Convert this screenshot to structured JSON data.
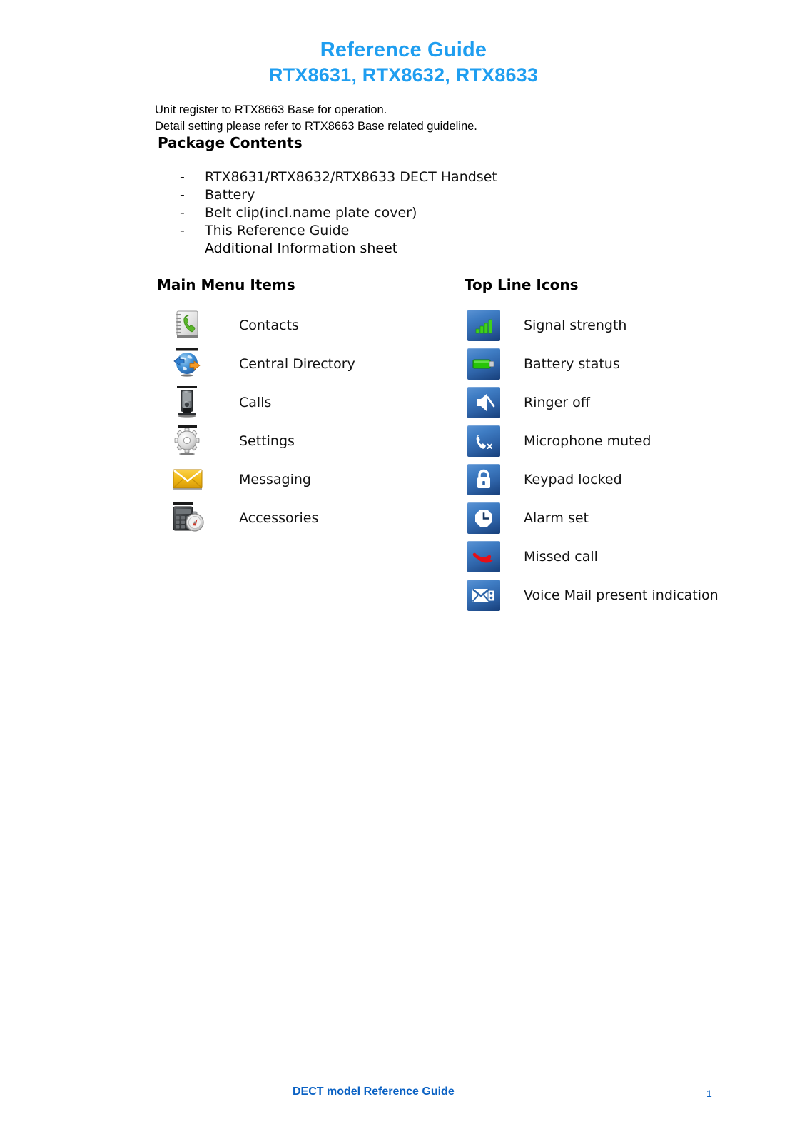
{
  "document": {
    "title": "Reference Guide",
    "subtitle": "RTX8631, RTX8632, RTX8633",
    "title_color": "#1f9ef0",
    "intro_line_1": "Unit register to RTX8663 Base for operation.",
    "intro_line_2": "Detail setting please refer to RTX8663 Base related guideline."
  },
  "package_contents": {
    "heading": "Package Contents",
    "bullet": "-",
    "items": [
      "RTX8631/RTX8632/RTX8633 DECT Handset",
      "Battery",
      "Belt clip(incl.name plate cover)",
      "This Reference Guide"
    ],
    "continuation": "Additional Information sheet"
  },
  "main_menu": {
    "heading": "Main Menu Items",
    "items": [
      {
        "icon": "contacts-notebook-icon",
        "label": "Contacts"
      },
      {
        "icon": "globe-central-directory-icon",
        "label": "Central Directory"
      },
      {
        "icon": "handset-base-calls-icon",
        "label": "Calls"
      },
      {
        "icon": "gear-settings-icon",
        "label": "Settings"
      },
      {
        "icon": "envelope-messaging-icon",
        "label": "Messaging"
      },
      {
        "icon": "calculator-stopwatch-accessories-icon",
        "label": "Accessories"
      }
    ]
  },
  "top_line_icons": {
    "heading": "Top Line Icons",
    "tile_color_light": "#5b93d4",
    "tile_color_dark": "#173f7a",
    "items": [
      {
        "icon": "signal-strength-icon",
        "label": "Signal strength"
      },
      {
        "icon": "battery-status-icon",
        "label": "Battery status"
      },
      {
        "icon": "ringer-off-icon",
        "label": "Ringer off"
      },
      {
        "icon": "microphone-muted-icon",
        "label": "Microphone muted"
      },
      {
        "icon": "keypad-locked-icon",
        "label": "Keypad locked"
      },
      {
        "icon": "alarm-set-icon",
        "label": "Alarm set"
      },
      {
        "icon": "missed-call-icon",
        "label": "Missed call"
      },
      {
        "icon": "voice-mail-icon",
        "label": "Voice Mail present indication"
      }
    ]
  },
  "footer": {
    "title": "DECT model Reference Guide",
    "page_number": "1",
    "color": "#0b62c4"
  }
}
